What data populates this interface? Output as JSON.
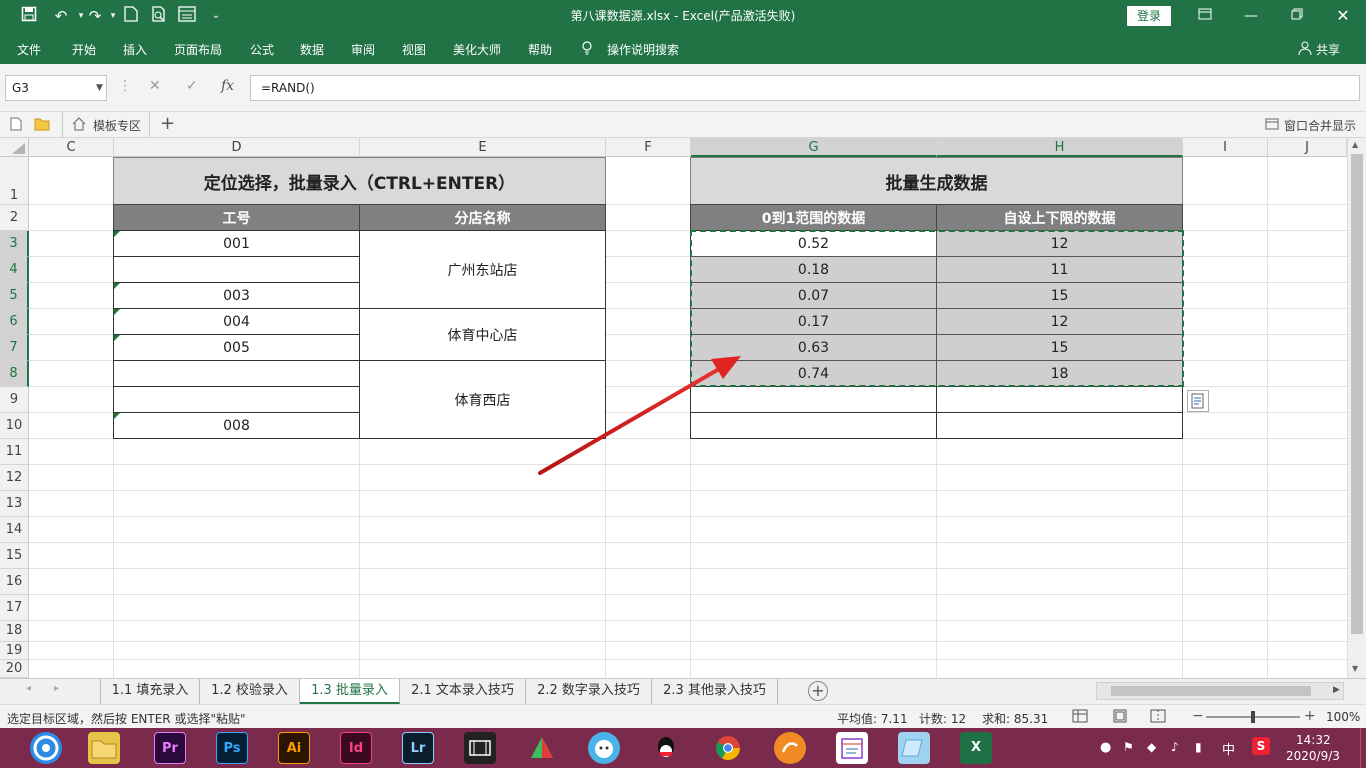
{
  "titlebar": {
    "title": "第八课数据源.xlsx  -  Excel(产品激活失败)",
    "login": "登录",
    "quick_access": [
      "save-icon",
      "undo-icon",
      "redo-icon",
      "new-icon",
      "print-preview-icon",
      "form-icon",
      "customize-icon"
    ]
  },
  "ribbon": {
    "tabs": [
      "文件",
      "开始",
      "插入",
      "页面布局",
      "公式",
      "数据",
      "审阅",
      "视图",
      "美化大师",
      "帮助"
    ],
    "tell_me": "操作说明搜索",
    "share": "共享"
  },
  "formula_bar": {
    "name_box": "G3",
    "fx": "fx",
    "formula": "=RAND()"
  },
  "doc_strip": {
    "template_tab": "模板专区",
    "merge_display": "窗口合并显示"
  },
  "columns": [
    "C",
    "D",
    "E",
    "F",
    "G",
    "H",
    "I",
    "J"
  ],
  "rows": [
    "1",
    "2",
    "3",
    "4",
    "5",
    "6",
    "7",
    "8",
    "9",
    "10",
    "11",
    "12",
    "13",
    "14",
    "15",
    "16",
    "17",
    "18",
    "19",
    "20"
  ],
  "left_table": {
    "title": "定位选择，批量录入（CTRL+ENTER）",
    "header_id": "工号",
    "header_store": "分店名称",
    "ids": [
      "001",
      "",
      "003",
      "004",
      "005",
      "",
      "",
      "008"
    ],
    "stores": [
      "广州东站店",
      "体育中心店",
      "体育西店"
    ]
  },
  "right_table": {
    "title": "批量生成数据",
    "header_rand": "0到1范围的数据",
    "header_custom": "自设上下限的数据",
    "rand_values": [
      "0.52",
      "0.18",
      "0.07",
      "0.17",
      "0.63",
      "0.74"
    ],
    "custom_values": [
      "12",
      "11",
      "15",
      "12",
      "15",
      "18"
    ]
  },
  "sheet_tabs": [
    "1.1 填充录入",
    "1.2 校验录入",
    "1.3 批量录入",
    "2.1 文本录入技巧",
    "2.2 数字录入技巧",
    "2.3 其他录入技巧"
  ],
  "active_sheet": "1.3 批量录入",
  "status": {
    "message": "选定目标区域，然后按 ENTER 或选择\"粘贴\"",
    "average": "平均值: 7.11",
    "count": "计数: 12",
    "sum": "求和: 85.31",
    "zoom": "100%"
  },
  "taskbar": {
    "apps": [
      "Pr",
      "Ps",
      "Ai",
      "Id",
      "Lr",
      "X"
    ],
    "time": "14:32",
    "date": "2020/9/3",
    "ime": "中"
  },
  "colors": {
    "excel_green": "#217346",
    "arrow_red": "#d62020",
    "header_grey": "#808080",
    "title_grey": "#d9d9d9"
  }
}
